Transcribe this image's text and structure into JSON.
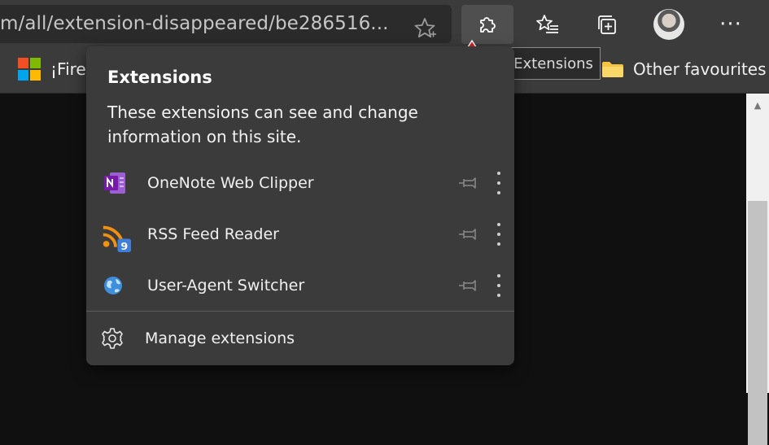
{
  "address_bar": {
    "url": "m/all/extension-disappeared/be286516..."
  },
  "toolbar": {
    "favorite_icon": "star-outline-icon",
    "extensions_icon": "puzzle-piece-icon",
    "favorites_icon": "star-list-icon",
    "collections_icon": "collections-icon",
    "more_label": "···"
  },
  "favorites_bar": {
    "items": [
      {
        "label": "¡Fireo",
        "icon": "microsoft-logo-icon"
      },
      {
        "label": "Other favourites",
        "icon": "folder-icon"
      }
    ]
  },
  "tooltip": {
    "text": "Extensions"
  },
  "extensions_popup": {
    "title": "Extensions",
    "description": "These extensions can see and change information on this site.",
    "extensions": [
      {
        "name": "OneNote Web Clipper",
        "icon": "onenote-icon"
      },
      {
        "name": "RSS Feed Reader",
        "icon": "rss-icon",
        "badge": "9"
      },
      {
        "name": "User-Agent Switcher",
        "icon": "globe-icon"
      }
    ],
    "manage_label": "Manage extensions"
  },
  "colors": {
    "toolbar_bg": "#3b3b3b",
    "popup_bg": "#3b3b3b",
    "page_bg": "#101010",
    "annotation_arrow": "#e02020"
  }
}
